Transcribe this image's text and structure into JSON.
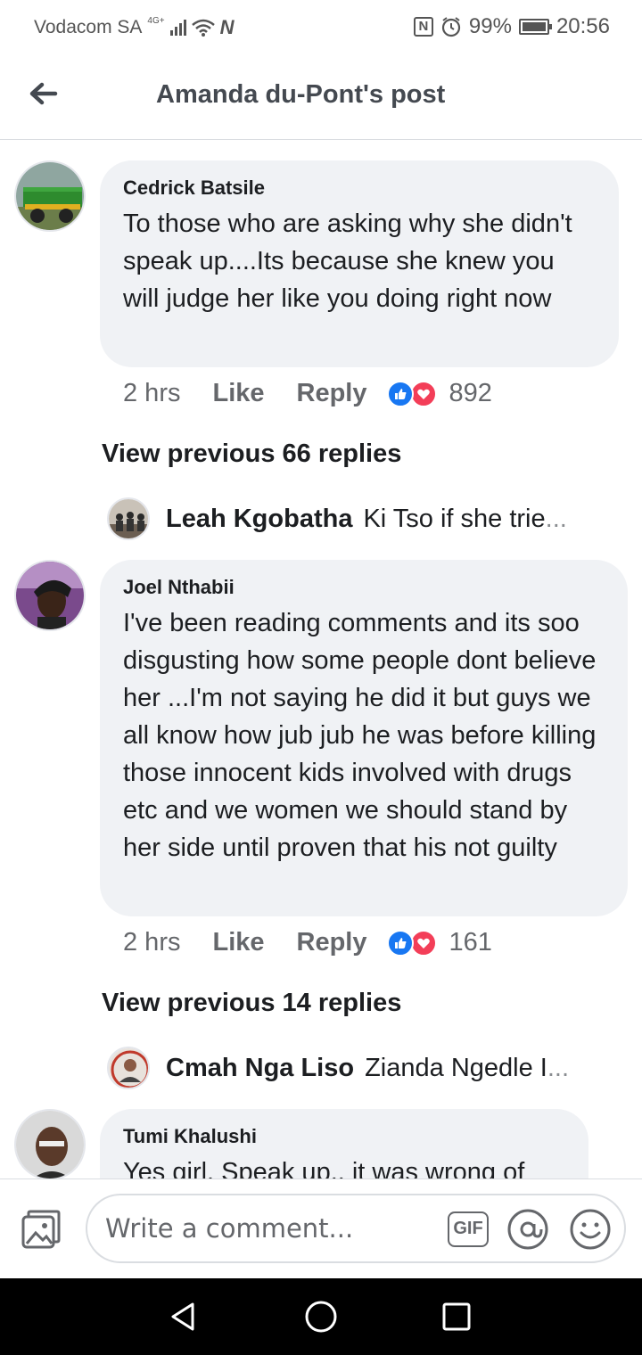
{
  "status_bar": {
    "carrier": "Vodacom SA",
    "network": "4G+",
    "battery": "99%",
    "time": "20:56"
  },
  "header": {
    "title": "Amanda du-Pont's post"
  },
  "comments": [
    {
      "name": "Cedrick Batsile",
      "text": "To those who are asking why she didn't speak up....Its because she knew you will judge her like you doing right now",
      "time": "2 hrs",
      "like": "Like",
      "reply": "Reply",
      "reaction_count": "892",
      "view_previous": "View previous 66 replies",
      "reply_preview": {
        "name": "Leah Kgobatha",
        "text": "Ki Tso if she trie",
        "ellipsis": "..."
      }
    },
    {
      "name": "Joel Nthabii",
      "text": "I've been reading comments and its soo disgusting how some people dont believe her ...I'm not saying he did it but guys we all know how jub jub he was before killing those innocent kids involved with drugs etc and we women we should stand by her side until proven that his not guilty",
      "time": "2 hrs",
      "like": "Like",
      "reply": "Reply",
      "reaction_count": "161",
      "view_previous": "View previous 14 replies",
      "reply_preview": {
        "name": "Cmah Nga Liso",
        "text": "Zianda Ngedle I",
        "ellipsis": " ..."
      }
    },
    {
      "name": "Tumi Khalushi",
      "text": "Yes girl. Speak up.. it was wrong of"
    }
  ],
  "composer": {
    "placeholder": "Write a comment...",
    "gif_label": "GIF"
  },
  "icons": {
    "back": "arrow-left-icon",
    "photo": "photo-icon",
    "at": "at-icon",
    "emoji": "emoji-icon",
    "like_reaction": "like-reaction-icon",
    "love_reaction": "love-reaction-icon"
  },
  "colors": {
    "bubble": "#f0f2f5",
    "like_blue": "#1877f2",
    "love_red": "#f33e58",
    "muted_text": "#65676b"
  }
}
